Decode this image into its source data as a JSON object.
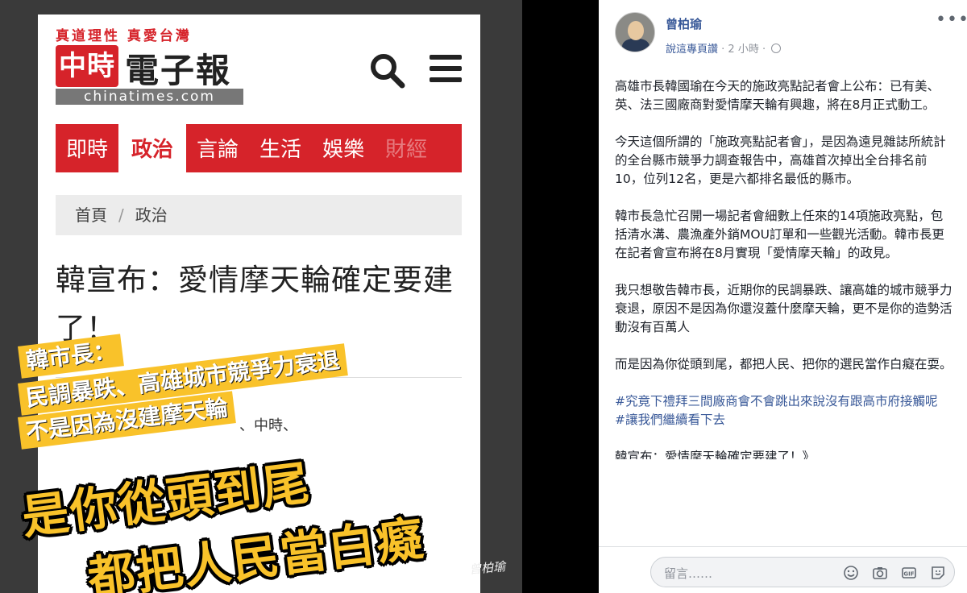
{
  "image": {
    "slogan": "真道理性 真愛台灣",
    "logo_mark": "中時",
    "logo_name": "電子報",
    "logo_domain": "chinatimes.com",
    "nav": [
      "即時",
      "政治",
      "言論",
      "生活",
      "娛樂",
      "財經"
    ],
    "active_nav": "政治",
    "breadcrumb": [
      "首頁",
      "政治"
    ],
    "headline": "韓宣布：愛情摩天輪確定要建了！",
    "byline": "、中時、",
    "overlay_lines": [
      "韓市長：",
      "民調暴跌、高雄城市競爭力衰退",
      "不是因為沒建摩天輪"
    ],
    "big_lines": [
      "是你從頭到尾",
      "都把人民當白癡"
    ],
    "signature": "曾柏瑜"
  },
  "post": {
    "author": "曾柏瑜",
    "meta_link": "說這專頁讚",
    "time": "· 2 小時 ·",
    "paragraphs": [
      "高雄市長韓國瑜在今天的施政亮點記者會上公布：已有美、英、法三國廠商對愛情摩天輪有興趣，將在8月正式動工。",
      "今天這個所謂的「施政亮點記者會」，是因為遠見雜誌所統計的全台縣市競爭力調查報告中，高雄首次掉出全台排名前10，位列12名，更是六都排名最低的縣市。",
      "韓市長急忙召開一場記者會細數上任來的14項施政亮點，包括清水溝、農漁產外銷MOU訂單和一些觀光活動。韓市長更在記者會宣布將在8月實現「愛情摩天輪」的政見。",
      "我只想敬告韓市長，近期你的民調暴跌、讓高雄的城市競爭力衰退，原因不是因為你還沒蓋什麼摩天輪，更不是你的造勢活動沒有百萬人",
      "而是因為你從頭到尾，都把人民、把你的選民當作白癡在耍。"
    ],
    "hashtags": [
      "#究竟下禮拜三間廠商會不會跳出來說沒有跟高市府接觸呢",
      "#讓我們繼續看下去"
    ],
    "cut_line": "韓宣布：愛情摩天輪確定要建了！》",
    "comment_placeholder": "留言……"
  }
}
